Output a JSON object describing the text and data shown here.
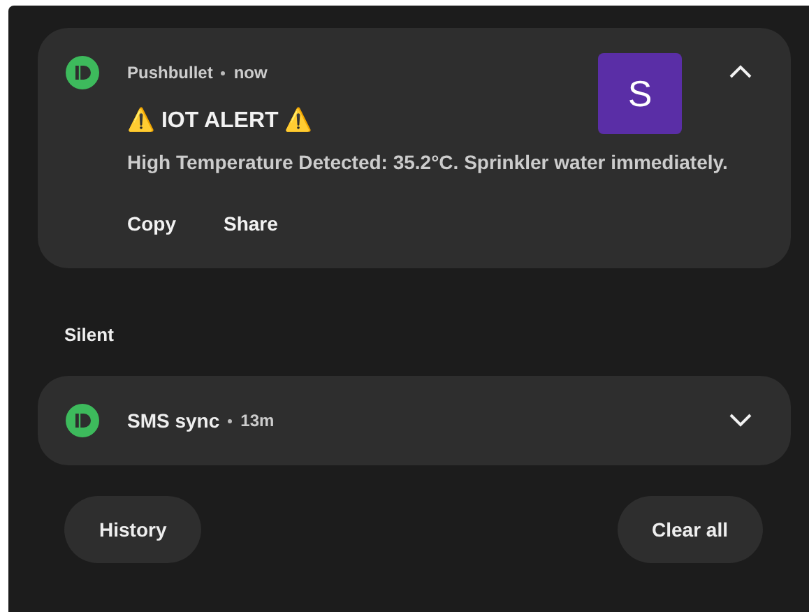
{
  "groups": [
    {
      "notifications": [
        {
          "app": "Pushbullet",
          "time": "now",
          "expanded": true,
          "title": "⚠️ IOT ALERT ⚠️",
          "body": "High Temperature Detected: 35.2°C. Sprinkler water immediately.",
          "avatar": "S",
          "actions": [
            "Copy",
            "Share"
          ]
        }
      ]
    },
    {
      "label": "Silent",
      "notifications": [
        {
          "app": "SMS sync",
          "time": "13m",
          "expanded": false
        }
      ]
    }
  ],
  "buttons": [
    "History",
    "Clear all"
  ]
}
